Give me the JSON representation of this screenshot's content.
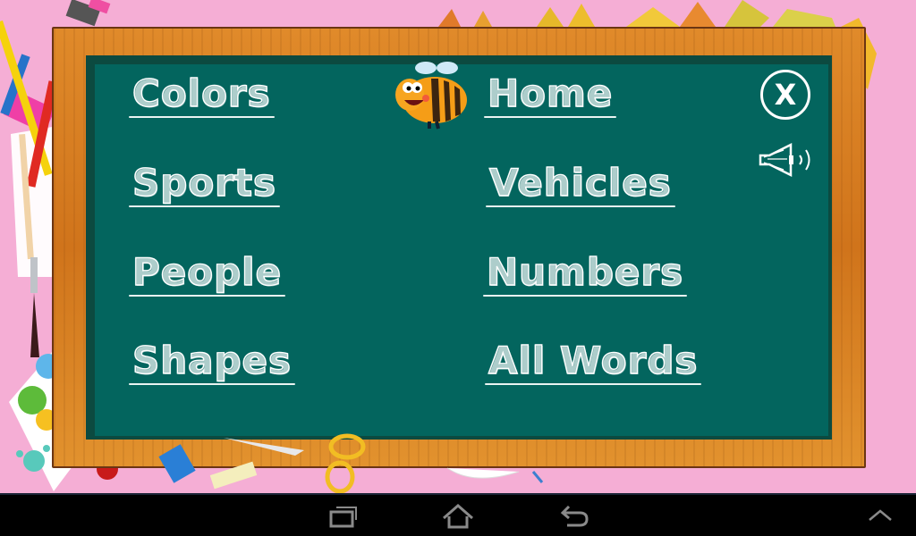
{
  "menu": {
    "left": [
      "Colors",
      "Sports",
      "People",
      "Shapes"
    ],
    "right": [
      "Home",
      "Vehicles",
      "Numbers",
      "All Words"
    ]
  },
  "controls": {
    "close_label": "X",
    "close_icon": "close-circle-icon",
    "sound_icon": "speaker-icon"
  },
  "navbar": {
    "recent_icon": "recent-apps-icon",
    "home_icon": "home-icon",
    "back_icon": "back-icon",
    "menu_icon": "chevron-up-icon"
  },
  "colors": {
    "background": "#f5aed5",
    "board": "#03655e",
    "frame": "#d0741b",
    "chalk": "#ffffff"
  }
}
